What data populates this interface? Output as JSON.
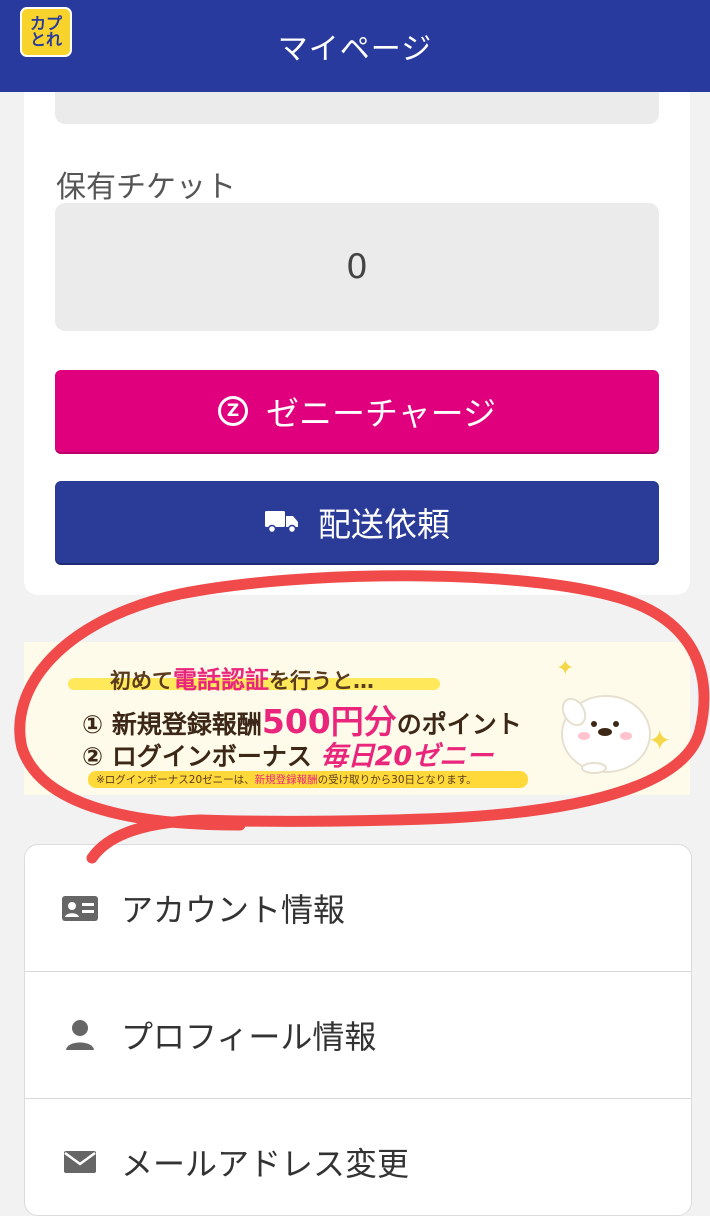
{
  "header": {
    "title": "マイページ",
    "logo_top": "カプ",
    "logo_bottom": "とれ"
  },
  "ticket": {
    "label": "保有チケット",
    "value": "0"
  },
  "buttons": {
    "charge_label": "ゼニーチャージ",
    "charge_icon_text": "Z",
    "ship_label": "配送依頼"
  },
  "banner": {
    "line1_prefix": "初めて",
    "line1_highlight": "電話認証",
    "line1_suffix": "を行うと…",
    "line2_prefix": "① 新規登録報酬",
    "line2_highlight": "500円分",
    "line2_suffix": "のポイント",
    "line3_prefix": "② ログインボーナス",
    "line3_highlight": "毎日20ゼニー",
    "note_prefix": "※ログインボーナス20ゼニーは、",
    "note_highlight": "新規登録報酬",
    "note_suffix": "の受け取りから30日となります。"
  },
  "menu": {
    "items": [
      {
        "label": "アカウント情報",
        "icon": "id-card-icon"
      },
      {
        "label": "プロフィール情報",
        "icon": "user-icon"
      },
      {
        "label": "メールアドレス変更",
        "icon": "envelope-icon"
      }
    ]
  },
  "colors": {
    "header": "#283a9e",
    "charge_button": "#e0007d",
    "ship_button": "#2b3c98",
    "annotation": "#f04a4a"
  }
}
